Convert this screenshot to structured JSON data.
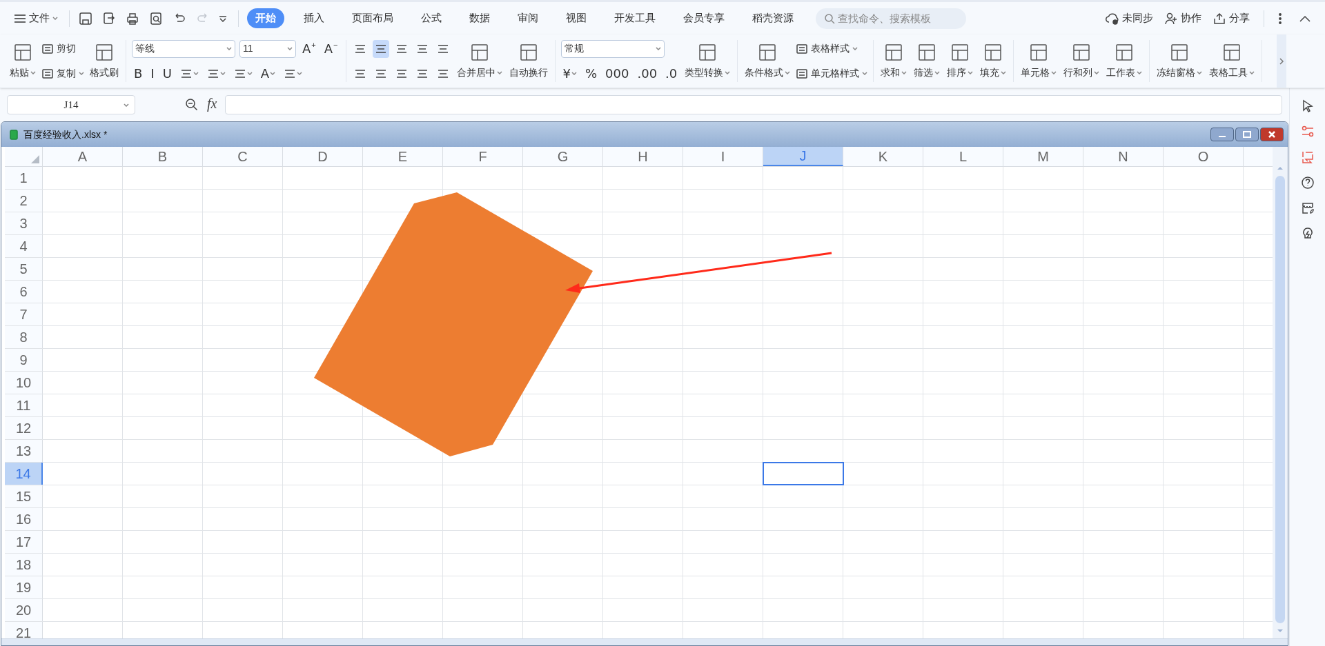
{
  "app_menu": {
    "label": "文件"
  },
  "quick_access": [
    {
      "disabled": false
    },
    {
      "disabled": false
    },
    {
      "disabled": false
    },
    {
      "disabled": false
    },
    {
      "disabled": false
    },
    {
      "disabled": true
    }
  ],
  "tabs": [
    {
      "label": "开始",
      "selected": true
    },
    {
      "label": "插入",
      "selected": false
    },
    {
      "label": "页面布局",
      "selected": false
    },
    {
      "label": "公式",
      "selected": false
    },
    {
      "label": "数据",
      "selected": false
    },
    {
      "label": "审阅",
      "selected": false
    },
    {
      "label": "视图",
      "selected": false
    },
    {
      "label": "开发工具",
      "selected": false
    },
    {
      "label": "会员专享",
      "selected": false
    },
    {
      "label": "稻壳资源",
      "selected": false
    }
  ],
  "search": {
    "placeholder": "查找命令、搜索模板"
  },
  "top_actions": [
    {
      "label": "未同步"
    },
    {
      "label": "协作"
    },
    {
      "label": "分享"
    }
  ],
  "ribbon": [
    {
      "cols": [
        {
          "kind": "large",
          "label": "粘贴",
          "dropdown": true
        },
        {
          "kind": "stack",
          "lines": [
            [
              {
                "kind": "small",
                "label": "剪切",
                "dropdown": false
              }
            ],
            [
              {
                "kind": "small",
                "label": "复制",
                "dropdown": true
              }
            ]
          ]
        },
        {
          "kind": "large",
          "label": "格式刷",
          "dropdown": false
        }
      ]
    },
    {
      "cols": [
        {
          "kind": "stack",
          "lines": [
            [
              {
                "kind": "wide-field",
                "value": "等线"
              },
              {
                "kind": "narrow-field",
                "value": "11"
              },
              {
                "kind": "glyph",
                "text": "A",
                "sup": "+",
                "dropdown": false,
                "selected": false
              },
              {
                "kind": "glyph",
                "text": "A",
                "sup": "−",
                "dropdown": false,
                "selected": false
              }
            ],
            [
              {
                "kind": "glyph",
                "text": "B",
                "dropdown": false,
                "selected": false
              },
              {
                "kind": "glyph",
                "text": "I",
                "dropdown": false,
                "selected": false
              },
              {
                "kind": "glyph",
                "text": "U",
                "dropdown": false,
                "selected": false
              },
              {
                "kind": "icon",
                "dropdown": true,
                "selected": false
              },
              {
                "kind": "icon",
                "dropdown": true,
                "selected": false
              },
              {
                "kind": "icon",
                "dropdown": true,
                "selected": false
              },
              {
                "kind": "glyph",
                "text": "A",
                "dropdown": true,
                "selected": false
              },
              {
                "kind": "icon",
                "dropdown": true,
                "selected": false
              }
            ]
          ]
        }
      ]
    },
    {
      "cols": [
        {
          "kind": "stack",
          "lines": [
            [
              {
                "kind": "icon",
                "dropdown": false,
                "selected": false
              },
              {
                "kind": "icon",
                "dropdown": false,
                "selected": true
              },
              {
                "kind": "icon",
                "dropdown": false,
                "selected": false
              },
              {
                "kind": "icon",
                "dropdown": false,
                "selected": false
              },
              {
                "kind": "icon",
                "dropdown": false,
                "selected": false
              }
            ],
            [
              {
                "kind": "icon",
                "dropdown": false,
                "selected": false
              },
              {
                "kind": "icon",
                "dropdown": false,
                "selected": false
              },
              {
                "kind": "icon",
                "dropdown": false,
                "selected": false
              },
              {
                "kind": "icon",
                "dropdown": false,
                "selected": false
              },
              {
                "kind": "icon",
                "dropdown": false,
                "selected": false
              }
            ]
          ]
        },
        {
          "kind": "large",
          "label": "合并居中",
          "dropdown": true
        },
        {
          "kind": "large",
          "label": "自动换行",
          "dropdown": false
        }
      ]
    },
    {
      "cols": [
        {
          "kind": "stack",
          "lines": [
            [
              {
                "kind": "wide-field",
                "value": "常规"
              }
            ],
            [
              {
                "kind": "glyph",
                "text": "¥",
                "dropdown": true,
                "selected": false
              },
              {
                "kind": "glyph",
                "text": "%",
                "dropdown": false,
                "selected": false
              },
              {
                "kind": "glyph",
                "text": "000",
                "dropdown": false,
                "selected": false
              },
              {
                "kind": "glyph",
                "text": ".00",
                "dropdown": false,
                "selected": false
              },
              {
                "kind": "glyph",
                "text": ".0",
                "dropdown": false,
                "selected": false
              }
            ]
          ]
        },
        {
          "kind": "large",
          "label": "类型转换",
          "dropdown": true
        }
      ]
    },
    {
      "cols": [
        {
          "kind": "large",
          "label": "条件格式",
          "dropdown": true
        },
        {
          "kind": "stack",
          "lines": [
            [
              {
                "kind": "small",
                "label": "表格样式",
                "dropdown": true
              }
            ],
            [
              {
                "kind": "small",
                "label": "单元格样式",
                "dropdown": true
              }
            ]
          ]
        }
      ]
    },
    {
      "cols": [
        {
          "kind": "large",
          "label": "求和",
          "dropdown": true
        },
        {
          "kind": "large",
          "label": "筛选",
          "dropdown": true
        },
        {
          "kind": "large",
          "label": "排序",
          "dropdown": true
        },
        {
          "kind": "large",
          "label": "填充",
          "dropdown": true
        }
      ]
    },
    {
      "cols": [
        {
          "kind": "large",
          "label": "单元格",
          "dropdown": true
        },
        {
          "kind": "large",
          "label": "行和列",
          "dropdown": true
        },
        {
          "kind": "large",
          "label": "工作表",
          "dropdown": true
        }
      ]
    },
    {
      "cols": [
        {
          "kind": "large",
          "label": "冻结窗格",
          "dropdown": true
        },
        {
          "kind": "large",
          "label": "表格工具",
          "dropdown": true
        }
      ]
    }
  ],
  "name_box": {
    "value": "J14"
  },
  "formula_bar": {
    "label": "fx"
  },
  "document": {
    "title": "百度经验收入.xlsx *"
  },
  "columns": [
    {
      "label": "A",
      "selected": false
    },
    {
      "label": "B",
      "selected": false
    },
    {
      "label": "C",
      "selected": false
    },
    {
      "label": "D",
      "selected": false
    },
    {
      "label": "E",
      "selected": false
    },
    {
      "label": "F",
      "selected": false
    },
    {
      "label": "G",
      "selected": false
    },
    {
      "label": "H",
      "selected": false
    },
    {
      "label": "I",
      "selected": false
    },
    {
      "label": "J",
      "selected": true
    },
    {
      "label": "K",
      "selected": false
    },
    {
      "label": "L",
      "selected": false
    },
    {
      "label": "M",
      "selected": false
    },
    {
      "label": "N",
      "selected": false
    },
    {
      "label": "O",
      "selected": false
    }
  ],
  "rows": [
    {
      "label": "1",
      "selected": false
    },
    {
      "label": "2",
      "selected": false
    },
    {
      "label": "3",
      "selected": false
    },
    {
      "label": "4",
      "selected": false
    },
    {
      "label": "5",
      "selected": false
    },
    {
      "label": "6",
      "selected": false
    },
    {
      "label": "7",
      "selected": false
    },
    {
      "label": "8",
      "selected": false
    },
    {
      "label": "9",
      "selected": false
    },
    {
      "label": "10",
      "selected": false
    },
    {
      "label": "11",
      "selected": false
    },
    {
      "label": "12",
      "selected": false
    },
    {
      "label": "13",
      "selected": false
    },
    {
      "label": "14",
      "selected": true
    },
    {
      "label": "15",
      "selected": false
    },
    {
      "label": "16",
      "selected": false
    },
    {
      "label": "17",
      "selected": false
    },
    {
      "label": "18",
      "selected": false
    },
    {
      "label": "19",
      "selected": false
    },
    {
      "label": "20",
      "selected": false
    },
    {
      "label": "21",
      "selected": false
    }
  ]
}
